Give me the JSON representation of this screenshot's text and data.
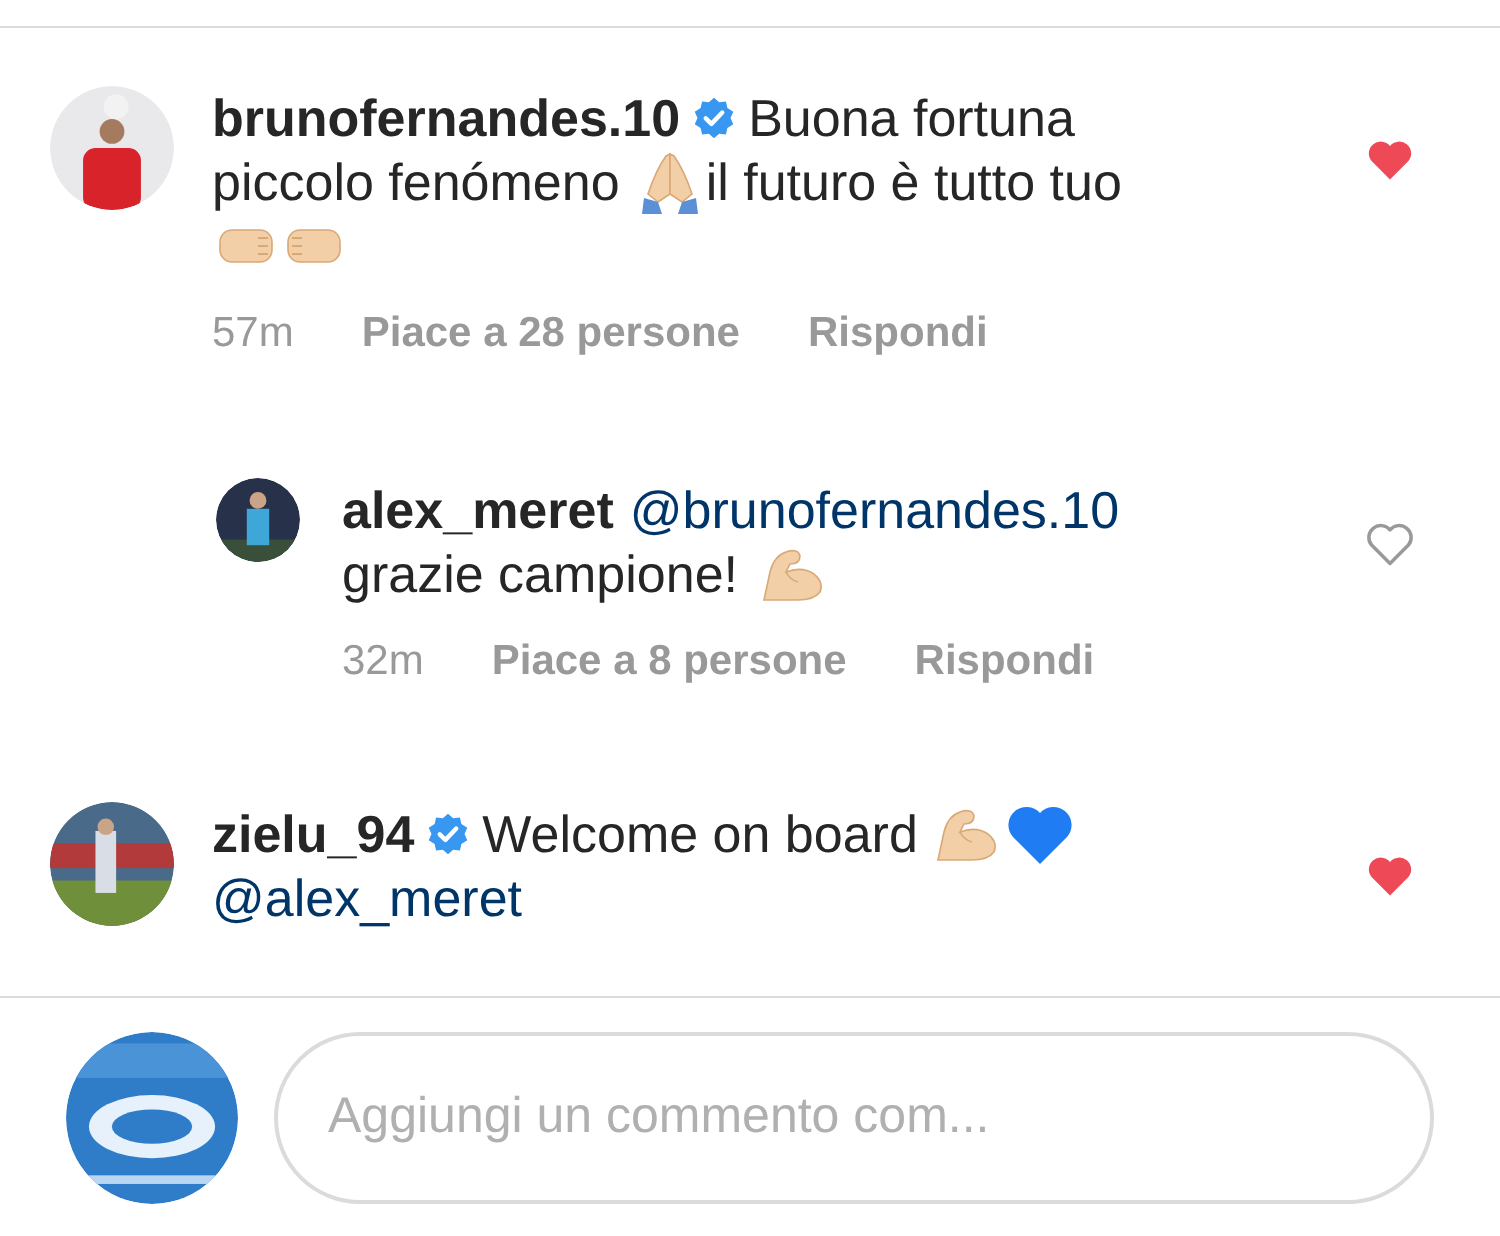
{
  "comments": [
    {
      "username": "brunofernandes.10",
      "verified": true,
      "liked": true,
      "lines": [
        [
          {
            "kind": "text",
            "text": "Buona fortuna"
          }
        ],
        [
          {
            "kind": "text",
            "text": "piccolo fenómeno"
          },
          {
            "kind": "hands"
          },
          {
            "kind": "text",
            "text": "il futuro è tutto tuo"
          }
        ],
        [
          {
            "kind": "fists"
          }
        ]
      ],
      "meta": {
        "time": "57m",
        "likes": "Piace a 28 persone",
        "reply": "Rispondi"
      },
      "replies": [
        {
          "username": "alex_meret",
          "verified": false,
          "liked": false,
          "lines": [
            [
              {
                "kind": "mention",
                "text": "@brunofernandes.10"
              }
            ],
            [
              {
                "kind": "text",
                "text": "grazie campione!"
              },
              {
                "kind": "arm"
              }
            ]
          ],
          "meta": {
            "time": "32m",
            "likes": "Piace a 8 persone",
            "reply": "Rispondi"
          }
        }
      ]
    },
    {
      "username": "zielu_94",
      "verified": true,
      "liked": true,
      "lines": [
        [
          {
            "kind": "text",
            "text": "Welcome on board"
          },
          {
            "kind": "arm_tight"
          },
          {
            "kind": "blue_heart"
          }
        ],
        [
          {
            "kind": "mention",
            "text": "@alex_meret"
          }
        ]
      ]
    }
  ],
  "composer": {
    "placeholder": "Aggiungi un commento com..."
  }
}
